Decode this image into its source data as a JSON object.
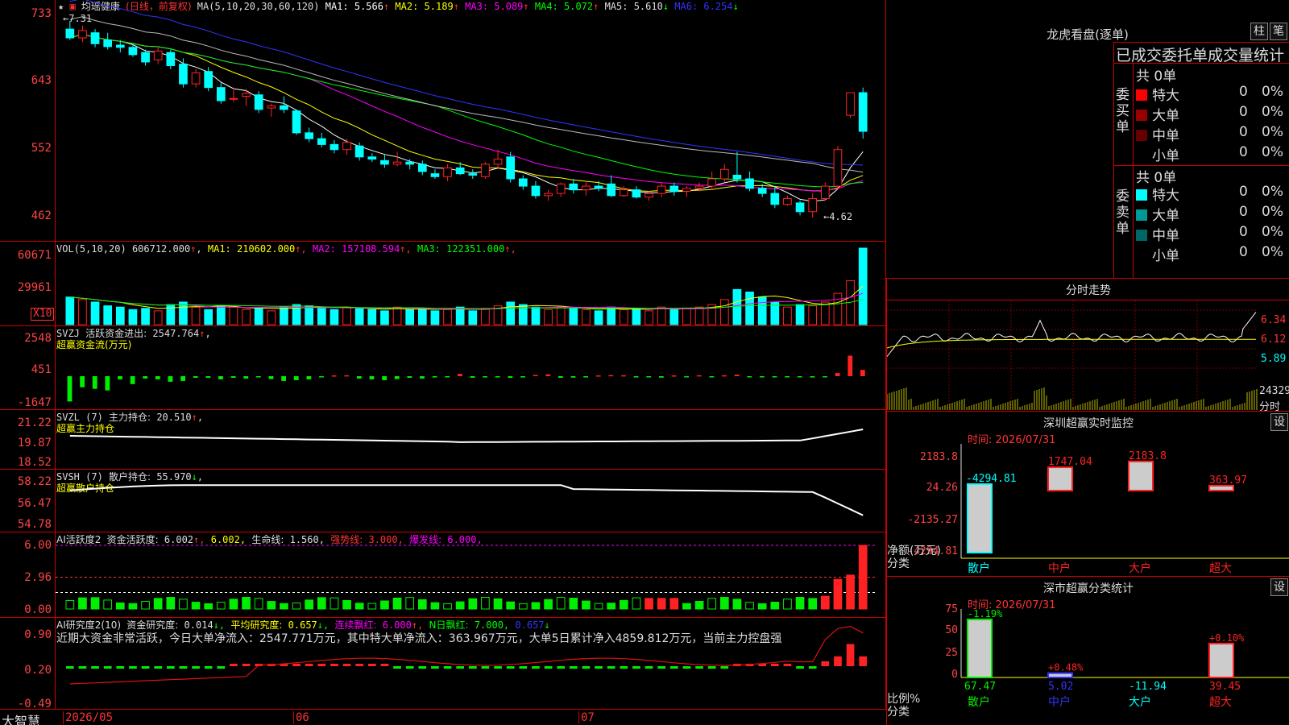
{
  "brand": "大智慧",
  "x_dates": [
    "2026/05",
    "06",
    "07"
  ],
  "main": {
    "stock_name": "均瑶健康",
    "mode": "(日线，前复权)",
    "ma_params": "MA(5,10,20,30,60,120)",
    "ma_values": [
      {
        "label": "MA1:",
        "value": "5.566",
        "arrow": "↑",
        "color": "#ffffff"
      },
      {
        "label": "MA2:",
        "value": "5.189",
        "arrow": "↑",
        "color": "#ffff00"
      },
      {
        "label": "MA3:",
        "value": "5.089",
        "arrow": "↑",
        "color": "#ff00ff"
      },
      {
        "label": "MA4:",
        "value": "5.072",
        "arrow": "↑",
        "color": "#00ff00"
      },
      {
        "label": "MA5:",
        "value": "5.610",
        "arrow": "↓",
        "color": "#dddddd"
      },
      {
        "label": "MA6:",
        "value": "6.254",
        "arrow": "↓",
        "color": "#3333ff"
      }
    ],
    "y_ticks": [
      "733",
      "643",
      "552",
      "462"
    ],
    "high_mark": "←7.31",
    "low_mark": "←4.62"
  },
  "vol": {
    "header": "VOL(5,10,20)",
    "value": "606712.000",
    "arrow": "↑",
    "ma_values": [
      {
        "label": "MA1:",
        "value": "210602.000",
        "arrow": "↑",
        "color": "#ffff00"
      },
      {
        "label": "MA2:",
        "value": "157108.594",
        "arrow": "↑",
        "color": "#ff00ff"
      },
      {
        "label": "MA3:",
        "value": "122351.000",
        "arrow": "↑",
        "color": "#00ff00"
      }
    ],
    "y_ticks": [
      "60671",
      "29961"
    ],
    "unit": "X10"
  },
  "svzj": {
    "header": "SVZJ",
    "label": "活跃资金进出:",
    "value": "2547.764",
    "arrow": "↑",
    "sub": "超赢资金流(万元)",
    "y_ticks": [
      "2548",
      "451",
      "-1647"
    ]
  },
  "svzl": {
    "header": "SVZL (7)",
    "label": "主力持仓:",
    "value": "20.510",
    "arrow": "↑",
    "sub": "超赢主力持仓",
    "y_ticks": [
      "21.22",
      "19.87",
      "18.52"
    ]
  },
  "svsh": {
    "header": "SVSH (7)",
    "label": "散户持仓:",
    "value": "55.970",
    "arrow": "↓",
    "sub": "超赢散户持仓",
    "y_ticks": [
      "58.22",
      "56.47",
      "54.78"
    ]
  },
  "ai_act": {
    "header": "AI活跃度2",
    "l1": "资金活跃度:",
    "v1": "6.002",
    "v2": "6.002,",
    "l3": "生命线:",
    "v3": "1.560,",
    "l4": "强势线:",
    "v4": "3.000,",
    "l5": "爆发线:",
    "v5": "6.000,",
    "y_ticks": [
      "6.00",
      "2.96",
      "0.00"
    ]
  },
  "ai_res": {
    "header": "AI研究度2(10)",
    "l1": "资金研究度:",
    "v1": "0.014",
    "l2": "平均研究度:",
    "v2": "0.657",
    "l3": "连续飘红:",
    "v3": "6.000",
    "l4": "N日飘红:",
    "v4": "7.000,",
    "v5": "0.657",
    "comment": "近期大资金非常活跃，今日大单净流入：2547.771万元，其中特大单净流入：363.967万元，大单5日累计净入4859.812万元，当前主力控盘强",
    "y_ticks": [
      "0.90",
      "0.20",
      "-0.49"
    ]
  },
  "lhb": {
    "title": "龙虎看盘(逐单)",
    "btn_bar": "柱",
    "btn_stroke": "笔",
    "subtitle": "已成交委托单成交量统计",
    "buy": {
      "label": "委买单",
      "total": "共 0单",
      "rows": [
        {
          "name": "特大",
          "count": "0",
          "pct": "0%",
          "color": "#ff0000"
        },
        {
          "name": "大单",
          "count": "0",
          "pct": "0%",
          "color": "#990000"
        },
        {
          "name": "中单",
          "count": "0",
          "pct": "0%",
          "color": "#660000"
        },
        {
          "name": "小单",
          "count": "0",
          "pct": "0%",
          "color": "#000000"
        }
      ]
    },
    "sell": {
      "label": "委卖单",
      "total": "共 0单",
      "rows": [
        {
          "name": "特大",
          "count": "0",
          "pct": "0%",
          "color": "#00ffff"
        },
        {
          "name": "大单",
          "count": "0",
          "pct": "0%",
          "color": "#009999"
        },
        {
          "name": "中单",
          "count": "0",
          "pct": "0%",
          "color": "#006666"
        },
        {
          "name": "小单",
          "count": "0",
          "pct": "0%",
          "color": "#000000"
        }
      ]
    }
  },
  "intraday": {
    "title": "分时走势",
    "y_ticks": [
      "6.34",
      "6.12",
      "5.89"
    ],
    "vol_lbl1": "24329",
    "vol_lbl2": "分时"
  },
  "monitor": {
    "title": "深圳超赢实时监控",
    "setting": "设",
    "time": "时间: 2026/07/31",
    "y_ticks": [
      "2183.8",
      "24.26",
      "-2135.27",
      "-4294.81"
    ],
    "y_label1": "净额(万元)",
    "y_label2": "分类",
    "bars": [
      {
        "cat": "散户",
        "value": "-4294.81"
      },
      {
        "cat": "中户",
        "value": "1747.04"
      },
      {
        "cat": "大户",
        "value": "2183.8"
      },
      {
        "cat": "超大",
        "value": "363.97"
      }
    ]
  },
  "classify": {
    "title": "深市超赢分类统计",
    "setting": "设",
    "time": "时间: 2026/07/31",
    "y_ticks": [
      "75",
      "50",
      "25",
      "0"
    ],
    "y_label1": "比例%",
    "y_label2": "分类",
    "bars": [
      {
        "cat": "散户",
        "pct": "-1.19%",
        "value": "67.47"
      },
      {
        "cat": "中户",
        "pct": "+0.48%",
        "value": "5.02"
      },
      {
        "cat": "大户",
        "pct": "",
        "value": "-11.94"
      },
      {
        "cat": "超大",
        "pct": "+0.10%",
        "value": "39.45"
      }
    ]
  },
  "chart_data": {
    "type": "candlestick",
    "title": "均瑶健康",
    "ohlc": [
      [
        7.2,
        7.31,
        7.05,
        7.08
      ],
      [
        7.08,
        7.25,
        7.02,
        7.18
      ],
      [
        7.15,
        7.2,
        6.95,
        7.0
      ],
      [
        7.05,
        7.15,
        6.92,
        6.96
      ],
      [
        6.98,
        7.05,
        6.88,
        6.95
      ],
      [
        6.95,
        7.0,
        6.82,
        6.85
      ],
      [
        6.88,
        6.92,
        6.7,
        6.75
      ],
      [
        6.78,
        6.95,
        6.72,
        6.9
      ],
      [
        6.88,
        6.92,
        6.65,
        6.7
      ],
      [
        6.72,
        6.8,
        6.4,
        6.45
      ],
      [
        6.45,
        6.65,
        6.4,
        6.6
      ],
      [
        6.62,
        6.68,
        6.35,
        6.4
      ],
      [
        6.4,
        6.48,
        6.18,
        6.22
      ],
      [
        6.25,
        6.4,
        6.2,
        6.25
      ],
      [
        6.28,
        6.38,
        6.15,
        6.32
      ],
      [
        6.3,
        6.35,
        6.05,
        6.1
      ],
      [
        6.12,
        6.18,
        6.0,
        6.15
      ],
      [
        6.15,
        6.28,
        6.05,
        6.1
      ],
      [
        6.08,
        6.1,
        5.75,
        5.78
      ],
      [
        5.78,
        5.85,
        5.65,
        5.7
      ],
      [
        5.7,
        5.78,
        5.58,
        5.62
      ],
      [
        5.62,
        5.68,
        5.5,
        5.55
      ],
      [
        5.55,
        5.7,
        5.48,
        5.65
      ],
      [
        5.6,
        5.65,
        5.4,
        5.45
      ],
      [
        5.45,
        5.5,
        5.38,
        5.42
      ],
      [
        5.4,
        5.48,
        5.3,
        5.35
      ],
      [
        5.35,
        5.52,
        5.32,
        5.38
      ],
      [
        5.38,
        5.42,
        5.28,
        5.35
      ],
      [
        5.35,
        5.4,
        5.2,
        5.25
      ],
      [
        5.22,
        5.28,
        5.15,
        5.18
      ],
      [
        5.18,
        5.35,
        5.12,
        5.3
      ],
      [
        5.3,
        5.38,
        5.2,
        5.22
      ],
      [
        5.22,
        5.28,
        5.15,
        5.2
      ],
      [
        5.18,
        5.38,
        5.15,
        5.35
      ],
      [
        5.35,
        5.55,
        5.3,
        5.42
      ],
      [
        5.45,
        5.52,
        5.1,
        5.15
      ],
      [
        5.15,
        5.2,
        5.0,
        5.05
      ],
      [
        5.05,
        5.12,
        4.88,
        4.92
      ],
      [
        4.92,
        5.0,
        4.85,
        4.95
      ],
      [
        4.95,
        5.1,
        4.9,
        5.08
      ],
      [
        5.08,
        5.15,
        4.95,
        5.0
      ],
      [
        5.0,
        5.12,
        4.92,
        5.05
      ],
      [
        5.05,
        5.12,
        4.98,
        5.02
      ],
      [
        5.08,
        5.2,
        4.9,
        4.92
      ],
      [
        4.92,
        5.05,
        4.9,
        5.0
      ],
      [
        5.0,
        5.05,
        4.88,
        4.9
      ],
      [
        4.9,
        4.98,
        4.85,
        4.95
      ],
      [
        4.95,
        5.1,
        4.9,
        5.05
      ],
      [
        5.05,
        5.1,
        4.92,
        4.98
      ],
      [
        4.98,
        5.05,
        4.9,
        5.02
      ],
      [
        5.02,
        5.1,
        4.98,
        5.05
      ],
      [
        5.05,
        5.25,
        5.0,
        5.15
      ],
      [
        5.15,
        5.35,
        5.1,
        5.28
      ],
      [
        5.2,
        5.52,
        5.1,
        5.15
      ],
      [
        5.15,
        5.25,
        4.98,
        5.02
      ],
      [
        5.02,
        5.08,
        4.9,
        4.95
      ],
      [
        4.95,
        5.05,
        4.75,
        4.8
      ],
      [
        4.8,
        4.92,
        4.78,
        4.88
      ],
      [
        4.82,
        4.85,
        4.65,
        4.7
      ],
      [
        4.7,
        4.95,
        4.62,
        4.88
      ],
      [
        4.88,
        5.1,
        4.85,
        5.05
      ],
      [
        5.05,
        5.6,
        5.0,
        5.55
      ],
      [
        6.02,
        6.33,
        5.98,
        6.33
      ],
      [
        6.33,
        6.4,
        5.7,
        5.8
      ]
    ],
    "volume": [
      22,
      20,
      18,
      15,
      14,
      12,
      13,
      11,
      16,
      18,
      14,
      12,
      15,
      14,
      12,
      13,
      11,
      14,
      16,
      15,
      13,
      12,
      14,
      13,
      12,
      11,
      14,
      12,
      13,
      11,
      12,
      14,
      11,
      13,
      15,
      18,
      16,
      14,
      12,
      14,
      13,
      12,
      11,
      14,
      12,
      13,
      11,
      14,
      12,
      13,
      14,
      16,
      20,
      28,
      26,
      22,
      18,
      14,
      16,
      15,
      18,
      25,
      35,
      61
    ],
    "ylim": [
      4.4,
      7.4
    ],
    "volume_ylim": [
      0,
      60671
    ]
  }
}
